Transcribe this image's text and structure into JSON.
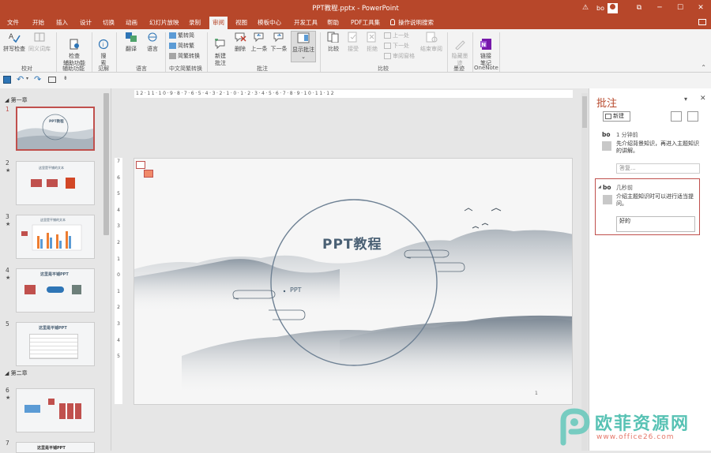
{
  "titlebar": {
    "title": "PPT教程.pptx - PowerPoint",
    "user": "bo",
    "warning": "⚠",
    "ribbon_display": "⧉",
    "minimize": "─",
    "maximize": "☐",
    "close": "✕"
  },
  "tabs": [
    "文件",
    "开始",
    "插入",
    "设计",
    "切换",
    "动画",
    "幻灯片放映",
    "录制",
    "审阅",
    "视图",
    "模板中心",
    "开发工具",
    "帮助",
    "PDF工具集"
  ],
  "active_tab": "审阅",
  "tell_me": "操作说明搜索",
  "ribbon": {
    "spelling": "拼写检查",
    "thesaurus": "同义词库",
    "proofing_group": "校对",
    "accessibility": "检查\n辅助功能",
    "accessibility_group": "辅助功能",
    "smart_lookup": "搜\n索",
    "insights_group": "见解",
    "translate": "翻译",
    "language": "语言",
    "language_group": "语言",
    "trad_to_simp": "繁转简",
    "simp_to_trad": "简转繁",
    "convert": "简繁转换",
    "chinese_group": "中文简繁转换",
    "new_comment": "新建\n批注",
    "delete": "删除",
    "previous": "上一条",
    "next": "下一条",
    "show_comments": "显示批注",
    "comments_group": "批注",
    "compare": "比较",
    "accept": "接受",
    "reject": "拒绝",
    "prev_change": "上一处",
    "next_change": "下一处",
    "reviewing_pane": "审阅窗格",
    "end_review": "结束审阅",
    "compare_group": "比较",
    "hide_ink": "隐藏墨\n迹",
    "ink_group": "墨迹",
    "linked_notes": "链接\n笔记",
    "onenote_group": "OneNote"
  },
  "qat": {
    "save": "💾",
    "undo": "↶",
    "redo": "↷",
    "customize": "⇟"
  },
  "slides_pane": {
    "section1": "第一章",
    "section2": "第二章",
    "nums": [
      "1",
      "2",
      "3",
      "4",
      "5",
      "6",
      "7"
    ],
    "star": "★",
    "thumb_titles": [
      "PPT教程",
      "这里是平铺的文本",
      "这里是平铺的文本",
      "这里是平铺PPT",
      "这里是平铺PPT",
      "",
      "这里是平铺PPT"
    ]
  },
  "ruler": {
    "h": "12·11·10·9·8·7·6·5·4·3·2·1·0·1·2·3·4·5·6·7·8·9·10·11·12",
    "v": [
      "7",
      "6",
      "5",
      "4",
      "3",
      "2",
      "1",
      "0",
      "1",
      "2",
      "3",
      "4",
      "5",
      "6",
      "7"
    ]
  },
  "slide": {
    "title": "PPT教程",
    "subtitle": "PPT",
    "page_number": "1"
  },
  "comments_pane": {
    "title": "批注",
    "close": "✕",
    "dropdown": "▾",
    "new_button": "新建",
    "comments": [
      {
        "author": "bo",
        "time": "1 分钟前",
        "text": "先介绍背景知识，再进入主题知识的讲解。",
        "reply_placeholder": "答复..."
      },
      {
        "author": "bo",
        "time": "几秒前",
        "text": "介绍主题知识时可以进行适当提问。",
        "reply_value": "好的"
      }
    ]
  },
  "watermark": {
    "brand": "欧菲资源网",
    "url": "www.office26.com"
  }
}
